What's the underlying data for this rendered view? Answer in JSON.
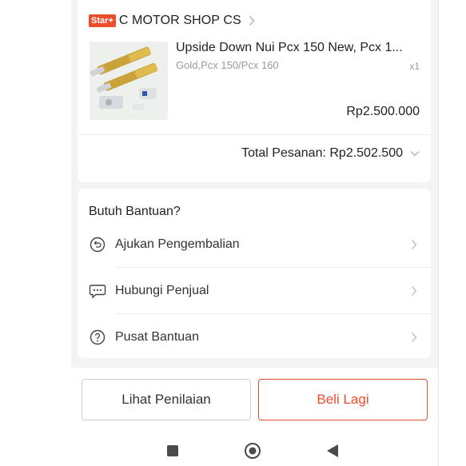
{
  "order": {
    "shop_badge": "Star+",
    "shop_name": "C MOTOR SHOP CS",
    "product_name": "Upside Down Nui Pcx 150 New, Pcx 1...",
    "product_variant": "Gold,Pcx 150/Pcx 160",
    "product_qty": "x1",
    "product_price": "Rp2.500.000",
    "total_label": "Total Pesanan: Rp2.502.500"
  },
  "help": {
    "title": "Butuh Bantuan?",
    "items": [
      {
        "label": "Ajukan Pengembalian",
        "icon": "return-icon"
      },
      {
        "label": "Hubungi Penjual",
        "icon": "chat-icon"
      },
      {
        "label": "Pusat Bantuan",
        "icon": "help-icon"
      }
    ]
  },
  "actions": {
    "review_label": "Lihat Penilaian",
    "buy_again_label": "Beli Lagi"
  },
  "colors": {
    "accent": "#ee4d2d",
    "background": "#f4f4f4"
  },
  "system_nav": {
    "icons": [
      "recents-square-icon",
      "home-circle-icon",
      "back-triangle-icon"
    ]
  }
}
